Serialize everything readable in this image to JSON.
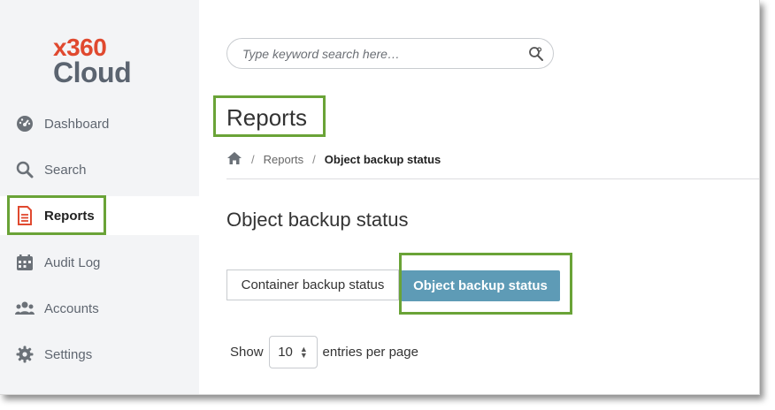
{
  "brand": {
    "line1": "x360",
    "line2": "Cloud"
  },
  "sidebar": {
    "items": [
      {
        "label": "Dashboard",
        "icon": "dashboard-gauge-icon"
      },
      {
        "label": "Search",
        "icon": "magnifier-icon"
      },
      {
        "label": "Reports",
        "icon": "document-icon",
        "active": true
      },
      {
        "label": "Audit Log",
        "icon": "calendar-icon"
      },
      {
        "label": "Accounts",
        "icon": "users-icon"
      },
      {
        "label": "Settings",
        "icon": "gear-icon"
      }
    ]
  },
  "search": {
    "placeholder": "Type keyword search here…",
    "icon": "search-gear-icon"
  },
  "page": {
    "title": "Reports"
  },
  "breadcrumb": {
    "home_icon": "home-icon",
    "separator": "/",
    "items": [
      "Reports",
      "Object backup status"
    ]
  },
  "section": {
    "title": "Object backup status"
  },
  "tabs": [
    {
      "label": "Container backup status",
      "active": false
    },
    {
      "label": "Object backup status",
      "active": true
    }
  ],
  "entries": {
    "show_label": "Show",
    "value": "10",
    "suffix": "entries per page"
  },
  "colors": {
    "accent": "#e0492f",
    "brand_gray": "#5b6470",
    "active_tab": "#5e9bb6",
    "highlight_box": "#6aa337",
    "sidebar_bg": "#f3f4f6"
  }
}
